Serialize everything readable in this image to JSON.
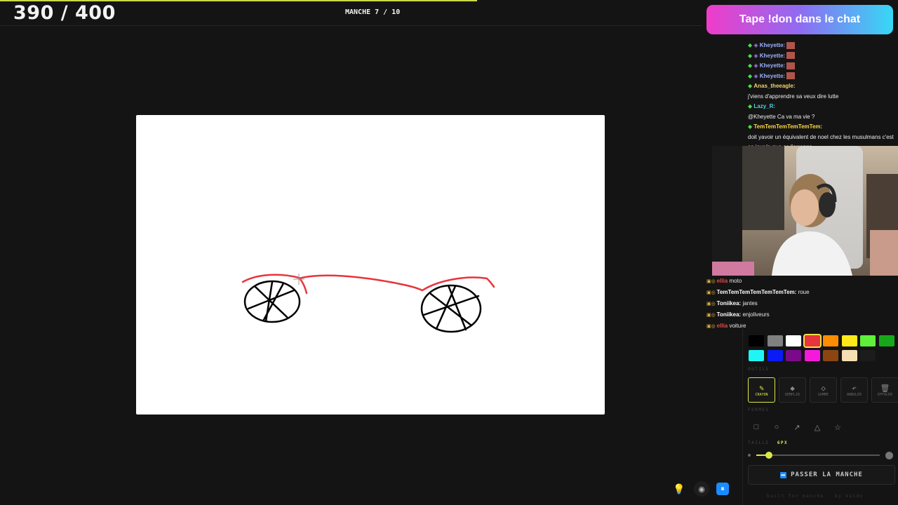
{
  "game": {
    "score": "390 / 400",
    "round": "MANCHE 7 / 10"
  },
  "banner": {
    "text": "Tape !don dans le chat"
  },
  "chat": [
    {
      "user": "Kheyette:",
      "text": "",
      "color": "#9ab0ff",
      "emote": true
    },
    {
      "user": "Kheyette:",
      "text": "",
      "color": "#9ab0ff",
      "emote": true
    },
    {
      "user": "Kheyette:",
      "text": "",
      "color": "#9ab0ff",
      "emote": true
    },
    {
      "user": "Kheyette:",
      "text": "",
      "color": "#9ab0ff",
      "emote": true
    },
    {
      "user": "Anas_theeagle:",
      "text": "j'viens d'apprendre sa veux dire lutte",
      "color": "#f5d26a",
      "emote": false
    },
    {
      "user": "Lazy_R:",
      "text": "@Kheyette Ca va ma vie ?",
      "color": "#4dd0e1",
      "emote": false
    },
    {
      "user": "TemTemTemTemTemTem:",
      "text": "doit yavoir un équivalent de noel chez les musulmans c'est ce jour la que ça l'arrange",
      "color": "#ffd84a",
      "emote": false
    }
  ],
  "guesses": [
    {
      "name": "ellia",
      "text": "moto",
      "color": "#e14a4a"
    },
    {
      "name": "TemTemTemTemTemTemTem:",
      "text": "roue",
      "color": "#ffffff"
    },
    {
      "name": "Toniikea:",
      "text": "jantes",
      "color": "#ffffff"
    },
    {
      "name": "Toniikea:",
      "text": "enjoliveurs",
      "color": "#ffffff"
    },
    {
      "name": "ellia",
      "text": "voiture",
      "color": "#e14a4a"
    }
  ],
  "palette": [
    {
      "name": "black",
      "color": "#000000",
      "selected": false
    },
    {
      "name": "gray",
      "color": "#808080",
      "selected": false
    },
    {
      "name": "white",
      "color": "#ffffff",
      "selected": false
    },
    {
      "name": "red",
      "color": "#e8343c",
      "selected": true
    },
    {
      "name": "orange",
      "color": "#ff8c00",
      "selected": false
    },
    {
      "name": "yellow",
      "color": "#ffe81a",
      "selected": false
    },
    {
      "name": "lime",
      "color": "#5ef03a",
      "selected": false
    },
    {
      "name": "green",
      "color": "#17a81a",
      "selected": false
    },
    {
      "name": "cyan",
      "color": "#1ff5f5",
      "selected": false
    },
    {
      "name": "blue",
      "color": "#0a1cf5",
      "selected": false
    },
    {
      "name": "purple",
      "color": "#7a0a8a",
      "selected": false
    },
    {
      "name": "magenta",
      "color": "#f51adb",
      "selected": false
    },
    {
      "name": "brown",
      "color": "#8b4513",
      "selected": false
    },
    {
      "name": "beige",
      "color": "#f5deb3",
      "selected": false
    },
    {
      "name": "custom",
      "color": "#1c1c1c",
      "selected": false
    }
  ],
  "sections": {
    "tools": "OUTILS",
    "shapes": "FORMES",
    "size": "TAILLE"
  },
  "tools": [
    {
      "id": "crayon",
      "label": "CRAYON",
      "icon": "pencil-icon",
      "glyph": "✎",
      "active": true
    },
    {
      "id": "remplir",
      "label": "REMPLIR",
      "icon": "bucket-icon",
      "glyph": "◆",
      "active": false
    },
    {
      "id": "gomme",
      "label": "GOMME",
      "icon": "eraser-icon",
      "glyph": "◇",
      "active": false
    },
    {
      "id": "annuler",
      "label": "ANNULER",
      "icon": "undo-icon",
      "glyph": "↶",
      "active": false
    },
    {
      "id": "effacer",
      "label": "EFFACER",
      "icon": "trash-icon",
      "glyph": "🗑",
      "active": false
    }
  ],
  "shapes": [
    {
      "id": "rect",
      "icon": "square-icon",
      "glyph": "□"
    },
    {
      "id": "ellipse",
      "icon": "circle-icon",
      "glyph": "○"
    },
    {
      "id": "arrow",
      "icon": "arrow-icon",
      "glyph": "↗"
    },
    {
      "id": "triangle",
      "icon": "triangle-icon",
      "glyph": "△"
    },
    {
      "id": "star",
      "icon": "star-icon",
      "glyph": "☆"
    }
  ],
  "size": {
    "value_label": "6PX",
    "fraction": 0.1
  },
  "skip": {
    "label": "PASSER LA MANCHE"
  },
  "footer": {
    "text": "built for manche · by keido"
  },
  "colors": {
    "accent": "#d8e84a",
    "brush_red": "#e8343c",
    "ink": "#000000"
  }
}
